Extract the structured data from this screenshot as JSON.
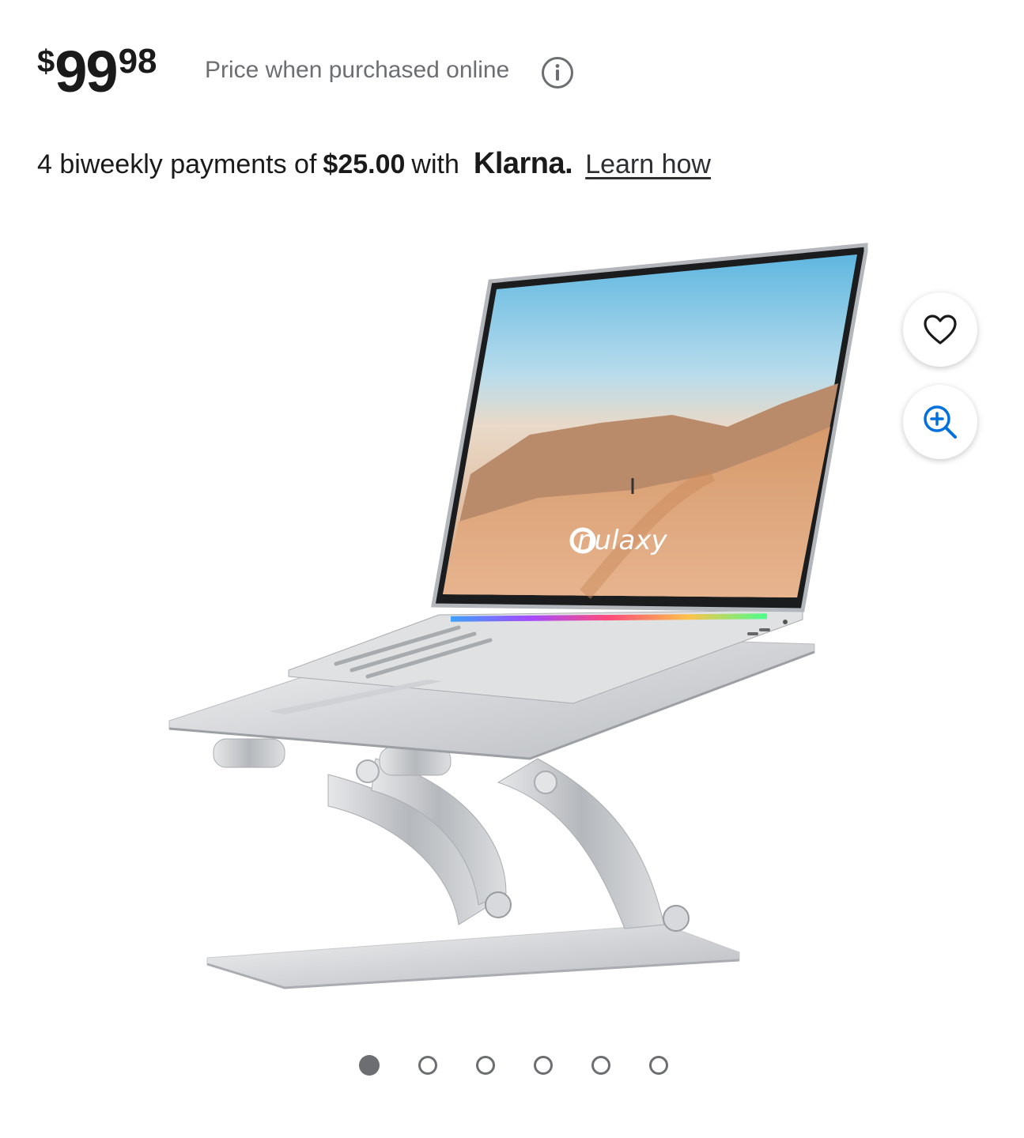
{
  "price": {
    "currency": "$",
    "whole": "99",
    "cents": "98",
    "note": "Price when purchased online"
  },
  "klarna": {
    "prefix": "4 biweekly payments of",
    "amount": "$25.00",
    "with": "with",
    "logo_text": "Klarna.",
    "link": "Learn how"
  },
  "product": {
    "screen_brand": "nulaxy"
  },
  "actions": {
    "favorite_icon": "heart-icon",
    "zoom_icon": "zoom-in-icon"
  },
  "carousel": {
    "total": 6,
    "active_index": 0
  },
  "colors": {
    "text": "#1a1a1a",
    "muted": "#6d6e71",
    "accent_blue": "#0071dc"
  }
}
